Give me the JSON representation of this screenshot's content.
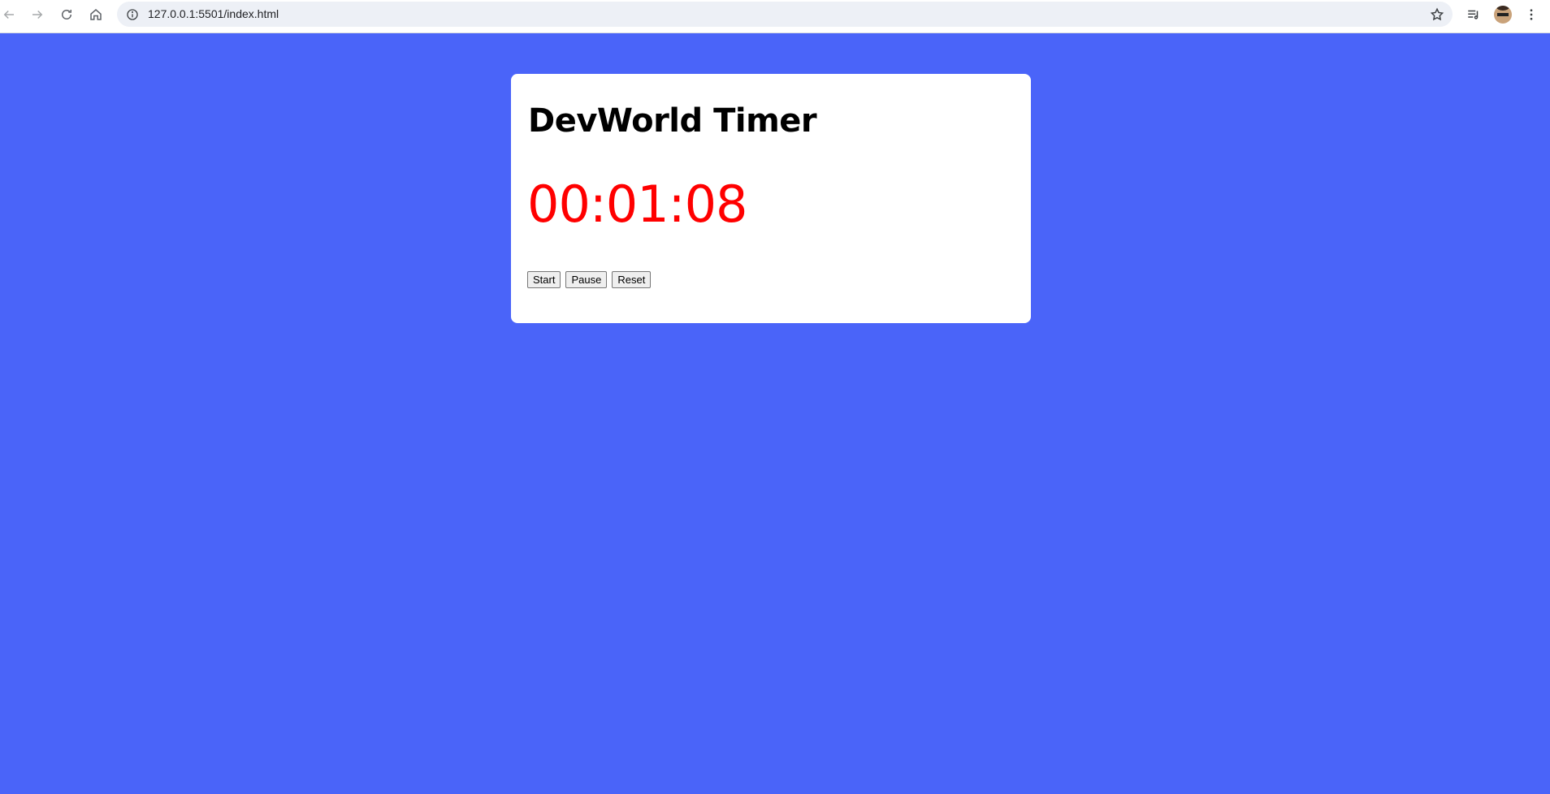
{
  "browser": {
    "url": "127.0.0.1:5501/index.html",
    "icons": {
      "back": "arrow-left-icon",
      "forward": "arrow-right-icon",
      "reload": "reload-icon",
      "home": "home-icon",
      "site_info": "info-icon",
      "bookmark": "star-icon",
      "media": "media-queue-icon",
      "profile": "avatar",
      "menu": "kebab-menu-icon"
    }
  },
  "page": {
    "background_color": "#4a64f9",
    "title": "DevWorld Timer",
    "timer": {
      "display": "00:01:08",
      "color": "#ff0000"
    },
    "buttons": {
      "start": "Start",
      "pause": "Pause",
      "reset": "Reset"
    }
  }
}
